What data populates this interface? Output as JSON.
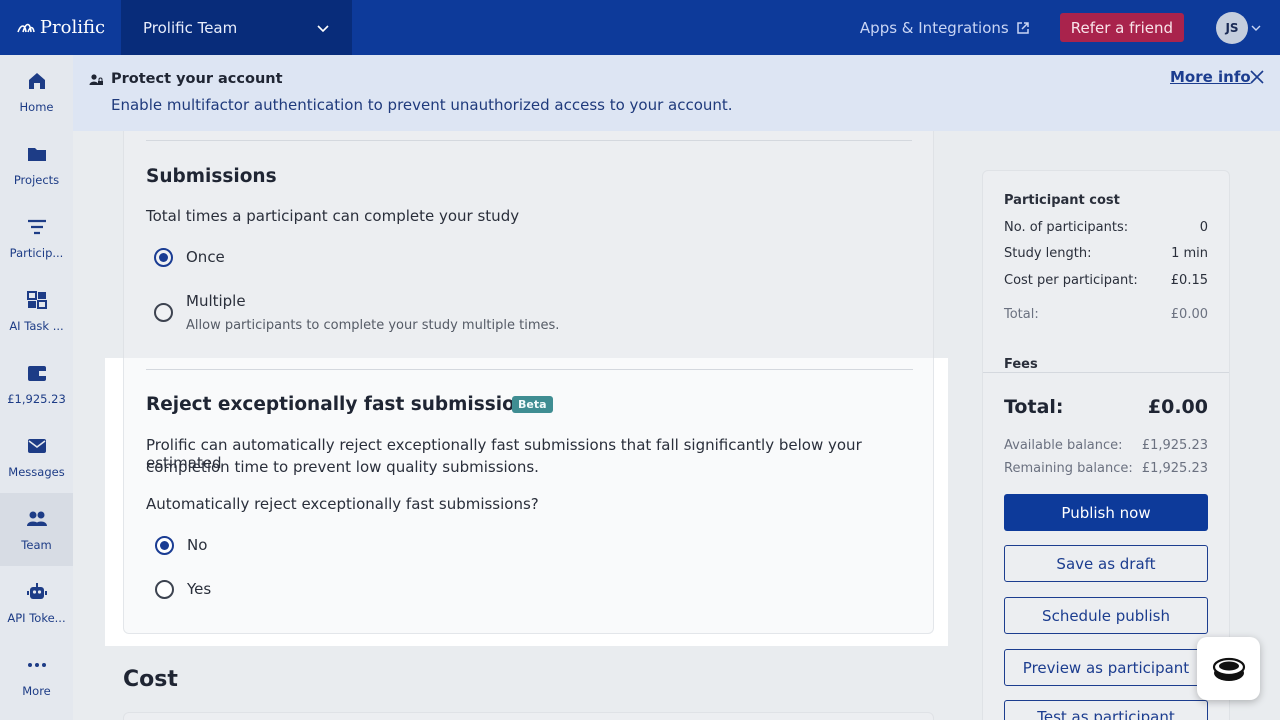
{
  "header": {
    "logo_text": "Prolific",
    "workspace": "Prolific Team",
    "apps_label": "Apps & Integrations",
    "refer_label": "Refer a friend",
    "avatar_initials": "JS"
  },
  "sidebar": {
    "items": [
      {
        "label": "Home",
        "icon": "home-icon"
      },
      {
        "label": "Projects",
        "icon": "folder-icon"
      },
      {
        "label": "Particip...",
        "icon": "filter-icon"
      },
      {
        "label": "AI Task ...",
        "icon": "ai-task-icon"
      },
      {
        "label": "£1,925.23",
        "icon": "wallet-icon"
      },
      {
        "label": "Messages",
        "icon": "mail-icon"
      },
      {
        "label": "Team",
        "icon": "team-icon"
      },
      {
        "label": "API Toke...",
        "icon": "robot-icon"
      },
      {
        "label": "More",
        "icon": "more-icon"
      }
    ]
  },
  "banner": {
    "title": "Protect your account",
    "text": "Enable multifactor authentication to prevent unauthorized access to your account.",
    "more_info": "More info"
  },
  "submissions": {
    "title": "Submissions",
    "question": "Total times a participant can complete your study",
    "options": [
      {
        "label": "Once",
        "checked": true
      },
      {
        "label": "Multiple",
        "checked": false,
        "help": "Allow participants to complete your study multiple times."
      }
    ]
  },
  "reject": {
    "title": "Reject exceptionally fast submissions",
    "badge": "Beta",
    "description_line1": "Prolific can automatically reject exceptionally fast submissions that fall significantly below your estimated",
    "description_line2": "completion time to prevent low quality submissions.",
    "question": "Automatically reject exceptionally fast submissions?",
    "options": [
      {
        "label": "No",
        "checked": true
      },
      {
        "label": "Yes",
        "checked": false
      }
    ]
  },
  "cost_title": "Cost",
  "summary": {
    "participant_cost_title": "Participant cost",
    "rows": [
      {
        "label": "No. of participants:",
        "value": "0"
      },
      {
        "label": "Study length:",
        "value": "1 min"
      },
      {
        "label": "Cost per participant:",
        "value": "£0.15"
      },
      {
        "label": "Total:",
        "value": "£0.00"
      }
    ],
    "fees_title": "Fees",
    "total_label": "Total:",
    "total_value": "£0.00",
    "available_label": "Available balance:",
    "available_value": "£1,925.23",
    "remaining_label": "Remaining balance:",
    "remaining_value": "£1,925.23",
    "buttons": {
      "publish": "Publish now",
      "draft": "Save as draft",
      "schedule": "Schedule publish",
      "preview": "Preview as participant",
      "test": "Test as participant"
    }
  },
  "colors": {
    "brand_blue": "#0d3a9a",
    "refer_red": "#a9234c",
    "beta_teal": "#3f8d92"
  }
}
